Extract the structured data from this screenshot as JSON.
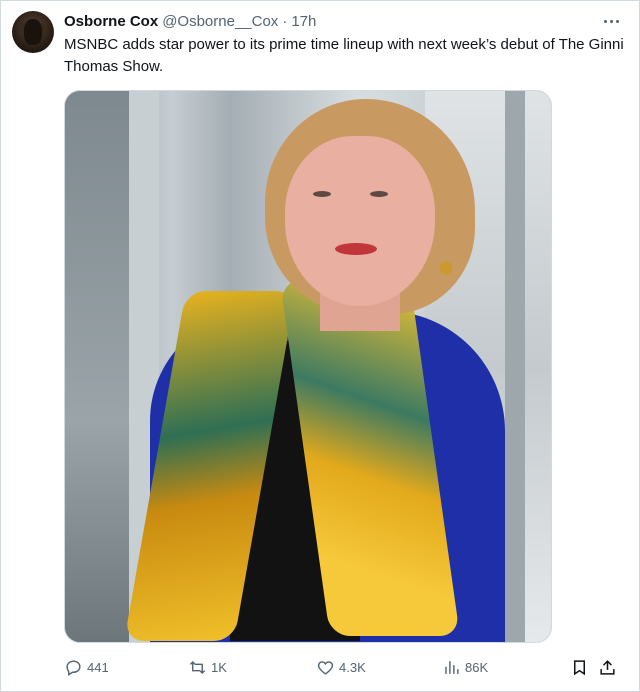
{
  "tweet": {
    "author_name": "Osborne Cox",
    "handle": "@Osborne__Cox",
    "separator": "·",
    "time": "17h",
    "text": "MSNBC adds star power to its prime time lineup with next week’s debut of The Ginni Thomas Show.",
    "more_icon": "more-horizontal-icon"
  },
  "actions": {
    "replies": "441",
    "reposts": "1K",
    "likes": "4.3K",
    "views": "86K",
    "reply_icon": "reply-icon",
    "repost_icon": "repost-icon",
    "like_icon": "heart-icon",
    "views_icon": "analytics-icon",
    "bookmark_icon": "bookmark-icon",
    "share_icon": "share-icon"
  },
  "colors": {
    "text": "#0f1419",
    "secondary": "#536471",
    "border": "#cfd9de"
  }
}
